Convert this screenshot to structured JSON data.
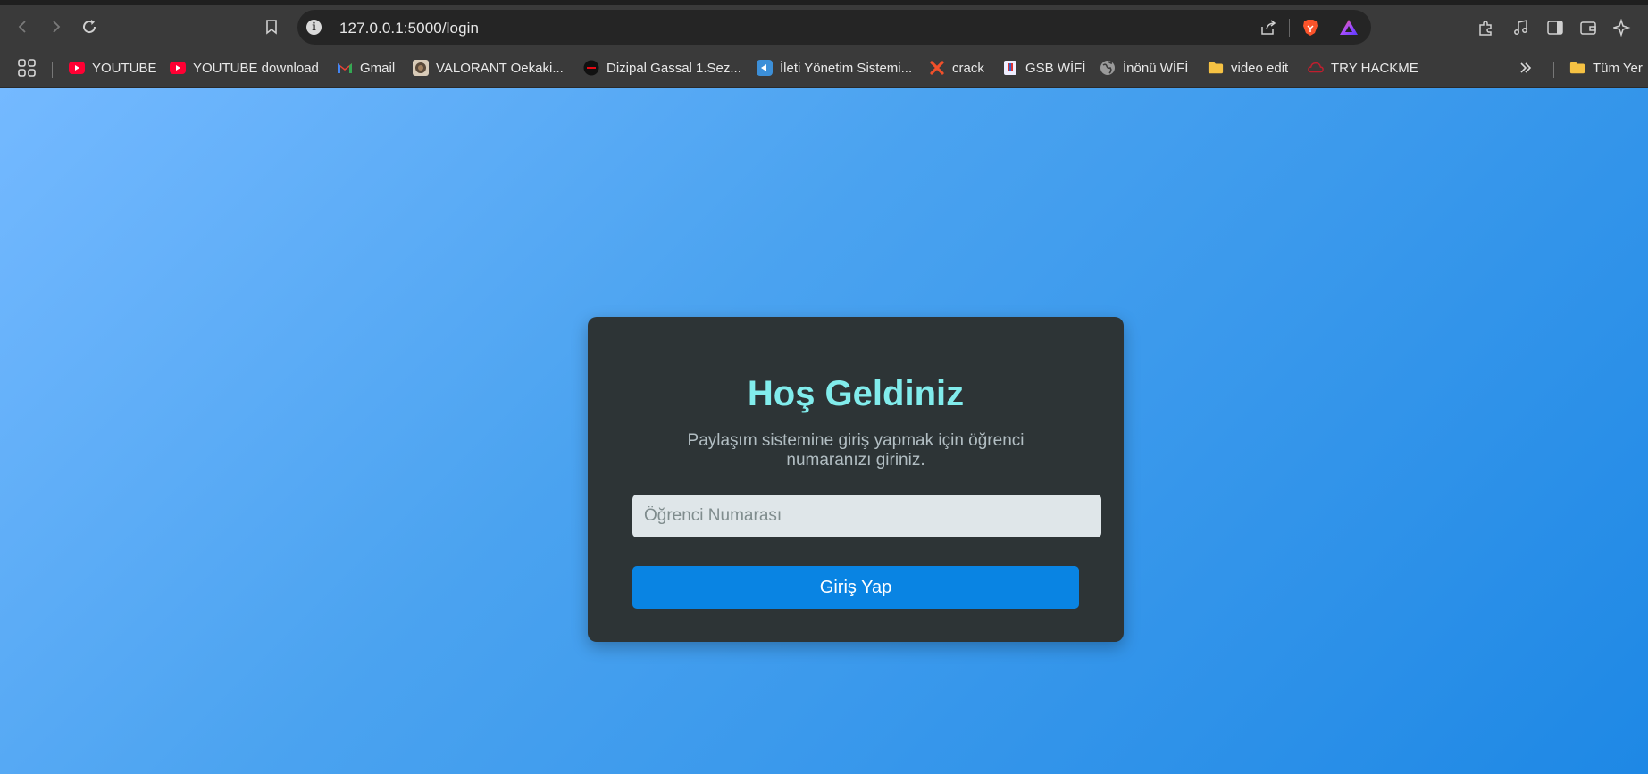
{
  "browser": {
    "url": "127.0.0.1:5000/login",
    "bookmarks": [
      {
        "label": "YOUTUBE",
        "icon": "youtube-icon"
      },
      {
        "label": "YOUTUBE download",
        "icon": "youtube-icon"
      },
      {
        "label": "Gmail",
        "icon": "gmail-icon"
      },
      {
        "label": "VALORANT Oekaki...",
        "icon": "valorant-icon"
      },
      {
        "label": "Dizipal Gassal 1.Sez...",
        "icon": "dizipal-icon"
      },
      {
        "label": "İleti Yönetim Sistemi...",
        "icon": "ileti-icon"
      },
      {
        "label": "crack",
        "icon": "crack-x-icon"
      },
      {
        "label": "GSB WİFİ",
        "icon": "gsb-icon"
      },
      {
        "label": "İnönü WİFİ",
        "icon": "globe-icon"
      },
      {
        "label": "video edit",
        "icon": "folder-icon"
      },
      {
        "label": "TRY HACKME",
        "icon": "tryhackme-icon"
      }
    ],
    "other_bookmarks_label": "Tüm Yer"
  },
  "login": {
    "title": "Hoş Geldiniz",
    "subtitle": "Paylaşım sistemine giriş yapmak için öğrenci numaranızı giriniz.",
    "input_placeholder": "Öğrenci Numarası",
    "input_value": "",
    "button_label": "Giriş Yap"
  },
  "colors": {
    "background_gradient_start": "#74b9ff",
    "background_gradient_end": "#1e88e5",
    "card": "#2d3436",
    "title": "#81ecec",
    "button": "#0984e3"
  }
}
